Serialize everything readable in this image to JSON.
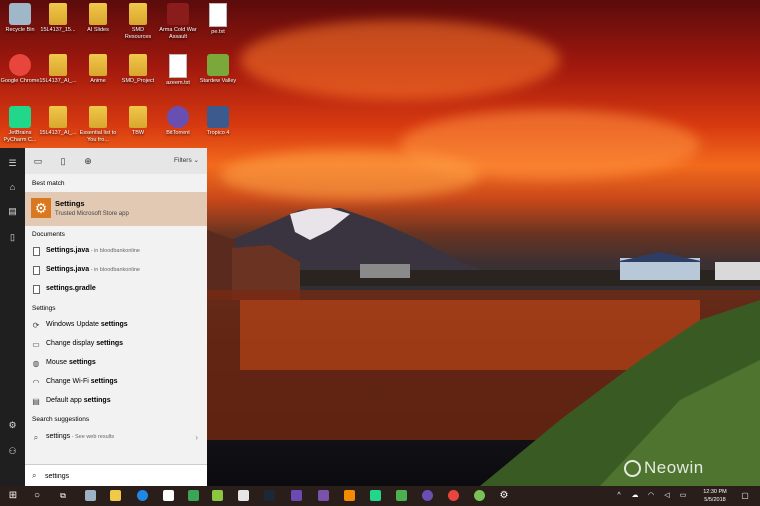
{
  "desktop": {
    "icons": [
      {
        "label": "Recycle Bin",
        "icon": "recycle-bin-icon",
        "color": "#9fb7c9"
      },
      {
        "label": "15L4137_15...",
        "icon": "folder-icon",
        "color": "#f0c84a"
      },
      {
        "label": "AI Slides",
        "icon": "folder-icon",
        "color": "#f0c84a"
      },
      {
        "label": "SMD Resources",
        "icon": "folder-icon",
        "color": "#f0c84a"
      },
      {
        "label": "Arma Cold War Assault",
        "icon": "arma-icon",
        "color": "#8b1c1c"
      },
      {
        "label": "pe.txt",
        "icon": "text-file-icon",
        "color": "#ffffff"
      },
      {
        "label": "Google Chrome",
        "icon": "chrome-icon",
        "color": "#e8453c"
      },
      {
        "label": "15L4137_AI_...",
        "icon": "folder-icon",
        "color": "#f0c84a"
      },
      {
        "label": "Anime",
        "icon": "folder-icon",
        "color": "#f0c84a"
      },
      {
        "label": "SMD_Project",
        "icon": "folder-icon",
        "color": "#f0c84a"
      },
      {
        "label": "azeem.txt",
        "icon": "text-file-icon",
        "color": "#ffffff"
      },
      {
        "label": "Stardew Valley",
        "icon": "stardew-icon",
        "color": "#7aa83a"
      },
      {
        "label": "JetBrains PyCharm C...",
        "icon": "pycharm-icon",
        "color": "#21d789"
      },
      {
        "label": "15L4137_AI_...",
        "icon": "folder-icon",
        "color": "#f0c84a"
      },
      {
        "label": "Essential list to You fro...",
        "icon": "folder-icon",
        "color": "#f0c84a"
      },
      {
        "label": "TBW",
        "icon": "folder-icon",
        "color": "#f0c84a"
      },
      {
        "label": "BitTorrent",
        "icon": "bittorrent-icon",
        "color": "#6a4fb3"
      },
      {
        "label": "Tropico 4",
        "icon": "tropico-icon",
        "color": "#3b5b8f"
      }
    ]
  },
  "rail": {
    "items": [
      "menu-icon",
      "home-icon",
      "documents-icon",
      "phone-icon",
      "settings-icon",
      "user-icon"
    ]
  },
  "search_panel": {
    "head_icons": [
      "apps-icon",
      "document-icon",
      "web-icon"
    ],
    "filters_label": "Filters",
    "best_match_header": "Best match",
    "best_match": {
      "title": "Settings",
      "subtitle": "Trusted Microsoft Store app"
    },
    "documents_header": "Documents",
    "documents": [
      {
        "name": "Settings.java",
        "sub": " - in bloodbankonline"
      },
      {
        "name": "Settings.java",
        "sub": " - in bloodbankonline"
      },
      {
        "name": "settings.gradle",
        "sub": ""
      }
    ],
    "settings_header": "Settings",
    "settings": [
      {
        "pre": "Windows Update ",
        "bold": "settings",
        "icon": "refresh-icon"
      },
      {
        "pre": "Change display ",
        "bold": "settings",
        "icon": "display-icon"
      },
      {
        "pre": "Mouse ",
        "bold": "settings",
        "icon": "mouse-icon"
      },
      {
        "pre": "Change Wi-Fi ",
        "bold": "settings",
        "icon": "wifi-icon"
      },
      {
        "pre": "Default app ",
        "bold": "settings",
        "icon": "default-apps-icon"
      }
    ],
    "suggestions_header": "Search suggestions",
    "suggestion": {
      "text": "settings",
      "sub": " - See web results"
    },
    "search_value": "settings"
  },
  "taskbar": {
    "pinned": [
      {
        "icon": "windows-start-icon",
        "color": "#ffffff"
      },
      {
        "icon": "cortana-icon",
        "color": "#ffffff"
      },
      {
        "icon": "task-view-icon",
        "color": "#ffffff"
      },
      {
        "icon": "storage-icon",
        "color": "#9bb3c4"
      },
      {
        "icon": "file-explorer-icon",
        "color": "#f0c84a"
      },
      {
        "icon": "edge-icon",
        "color": "#1e88e5"
      },
      {
        "icon": "store-icon",
        "color": "#ffffff"
      },
      {
        "icon": "green-app-icon",
        "color": "#3aa655"
      },
      {
        "icon": "notepad-plus-icon",
        "color": "#8cc63f"
      },
      {
        "icon": "paint-icon",
        "color": "#e6e6e6"
      },
      {
        "icon": "steam-icon",
        "color": "#1b2838"
      },
      {
        "icon": "intellij-icon",
        "color": "#6b4ab6"
      },
      {
        "icon": "visual-studio-icon",
        "color": "#7b52ab"
      },
      {
        "icon": "vlc-icon",
        "color": "#f48b00"
      },
      {
        "icon": "pycharm-icon",
        "color": "#21d789"
      },
      {
        "icon": "android-studio-icon",
        "color": "#4caf50"
      },
      {
        "icon": "bittorrent-icon",
        "color": "#6a4fb3"
      },
      {
        "icon": "chrome-icon",
        "color": "#e8453c"
      },
      {
        "icon": "android-icon",
        "color": "#78c257"
      },
      {
        "icon": "settings-gear-icon",
        "color": "#ffffff"
      }
    ],
    "clock_time": "12:30 PM",
    "clock_date": "5/5/2018",
    "watermark": "Neowin"
  }
}
